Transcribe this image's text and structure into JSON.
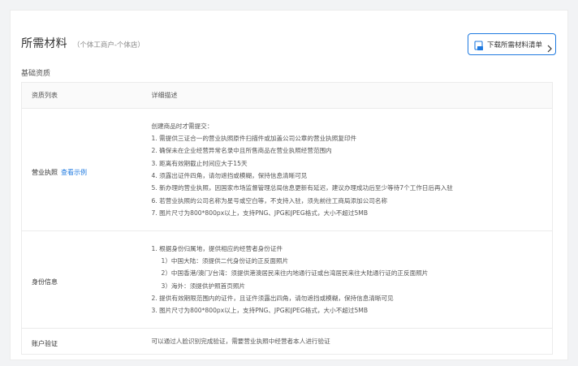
{
  "header": {
    "title": "所需材料",
    "subtitle": "（个体工商户-个体店）",
    "download_label": "下载所需材料清单"
  },
  "section_label": "基础资质",
  "table": {
    "columns": [
      "资质列表",
      "详细描述"
    ],
    "rows": [
      {
        "name": "营业执照",
        "link": "查看示例",
        "lines": [
          "创建商品时才需提交：",
          "1. 需提供三证合一的营业执照原件扫描件或加盖公司公章的营业执照复印件",
          "2. 确保未在企业经营异常名录中且所售商品在营业执照经营范围内",
          "3. 距离有效期截止时间应大于15天",
          "4. 须露出证件四角，请勿遮挡或模糊，保持信息清晰可见",
          "5. 新办理的营业执照，因国家市场监督管理总局信息更新有延迟，建议办理成功后至少等待7个工作日后再入驻",
          "6. 若营业执照的公司名称为星号或空白等，不支持入驻，须先前往工商局添加公司名称",
          "7. 图片尺寸为800*800px以上，支持PNG、JPG和JPEG格式，大小不超过5MB"
        ]
      },
      {
        "name": "身份信息",
        "lines": [
          {
            "text": "1. 根据身份归属地，提供相应的经营者身份证件",
            "indent": false
          },
          {
            "text": "1）中国大陆：须提供二代身份证的正反面照片",
            "indent": true
          },
          {
            "text": "2）中国香港/澳门/台湾：须提供港澳居民来往内地通行证或台湾居民来往大陆通行证的正反面照片",
            "indent": true
          },
          {
            "text": "3）海外：须提供护照首页照片",
            "indent": true
          },
          {
            "text": "2. 提供有效期限范围内的证件，且证件须露出四角，请勿遮挡或模糊，保持信息清晰可见",
            "indent": false
          },
          {
            "text": "3. 图片尺寸为800*800px以上，支持PNG、JPG和JPEG格式，大小不超过5MB",
            "indent": false
          }
        ]
      },
      {
        "name": "账户验证",
        "lines": [
          "可以通过人脸识别完成验证，需要营业执照中经营者本人进行验证"
        ]
      }
    ]
  },
  "colors": {
    "accent": "#1f7ae0",
    "border": "#ebebeb",
    "header_bg": "#fafafa"
  },
  "icons": {
    "download": "download-doc-icon",
    "chevron": "chevron-right-icon"
  }
}
